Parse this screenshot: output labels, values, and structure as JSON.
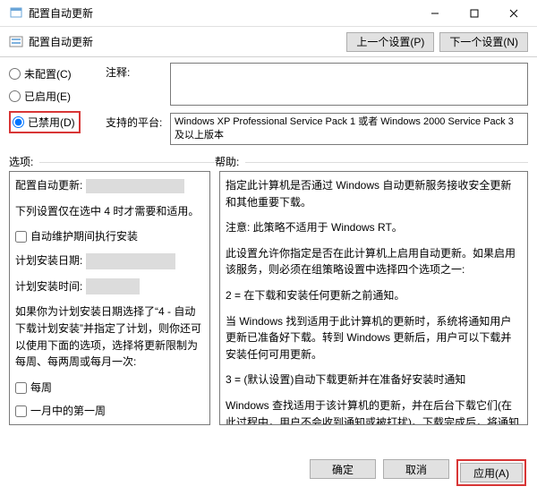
{
  "window": {
    "title": "配置自动更新",
    "sub": "配置自动更新"
  },
  "nav": {
    "prev": "上一个设置(P)",
    "next": "下一个设置(N)"
  },
  "radios": {
    "none": "未配置(C)",
    "enabled": "已启用(E)",
    "disabled": "已禁用(D)"
  },
  "fields": {
    "comment_label": "注释:",
    "comment_value": "",
    "platform_label": "支持的平台:",
    "platform_value": "Windows XP Professional Service Pack 1 或者 Windows 2000 Service Pack 3 及以上版本"
  },
  "sections": {
    "options": "选项:",
    "help": "帮助:"
  },
  "options": {
    "title": "配置自动更新:",
    "note": "下列设置仅在选中 4 时才需要和适用。",
    "cb_maint": "自动维护期间执行安装",
    "install_day_label": "计划安装日期:",
    "install_time_label": "计划安装时间:",
    "tip": "如果你为计划安装日期选择了“4 - 自动下载计划安装”并指定了计划，则你还可以使用下面的选项，选择将更新限制为每周、每两周或每月一次:",
    "cb_week": "每周",
    "cb_firstweek": "一月中的第一周"
  },
  "help": {
    "p1": "指定此计算机是否通过 Windows 自动更新服务接收安全更新和其他重要下载。",
    "p2": "注意: 此策略不适用于 Windows RT。",
    "p3": "此设置允许你指定是否在此计算机上启用自动更新。如果启用该服务，则必须在组策略设置中选择四个选项之一:",
    "p4": "2 = 在下载和安装任何更新之前通知。",
    "p5": "当 Windows 找到适用于此计算机的更新时，系统将通知用户更新已准备好下载。转到 Windows 更新后，用户可以下载并安装任何可用更新。",
    "p6": "3 = (默认设置)自动下载更新并在准备好安装时通知",
    "p7": "Windows 查找适用于该计算机的更新，并在后台下载它们(在此过程中，用户不会收到通知或被打扰)。下载完成后，将通知用户更新已准备好进行安装。在转到 Windows 更新后，用户可以安装它们。"
  },
  "footer": {
    "ok": "确定",
    "cancel": "取消",
    "apply": "应用(A)"
  }
}
